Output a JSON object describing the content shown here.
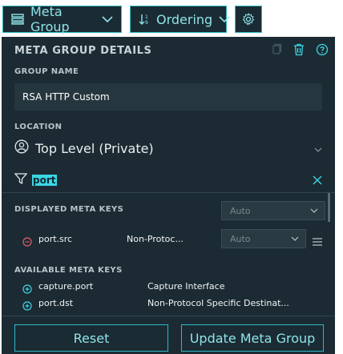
{
  "toolbar": {
    "meta_group_label": "Meta Group",
    "ordering_label": "Ordering",
    "meta_group_icon": "list-icon",
    "ordering_icon": "sort-icon",
    "settings_icon": "gear-icon"
  },
  "panel": {
    "title": "META GROUP DETAILS",
    "group_name_label": "GROUP NAME",
    "group_name_value": "RSA HTTP Custom",
    "location_label": "LOCATION",
    "location_value": "Top Level (Private)",
    "filter_value": "port",
    "displayed_keys_label": "DISPLAYED META KEYS",
    "displayed_keys_select": "Auto",
    "displayed_keys": [
      {
        "name": "port.src",
        "description": "Non-Protoc...",
        "mode": "Auto"
      }
    ],
    "available_keys_label": "AVAILABLE META KEYS",
    "available_keys": [
      {
        "name": "capture.port",
        "description": "Capture Interface"
      },
      {
        "name": "port.dst",
        "description": "Non-Protocol Specific Destinat..."
      }
    ],
    "reset_label": "Reset",
    "update_label": "Update Meta Group"
  },
  "colors": {
    "accent": "#2fb8c4",
    "panel_bg": "#1c2b33",
    "remove": "#e25b6a",
    "add": "#3ad6e4"
  }
}
